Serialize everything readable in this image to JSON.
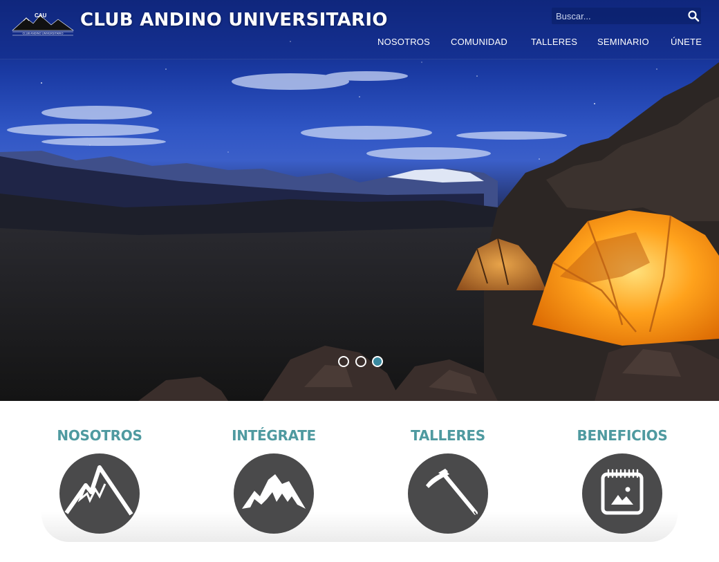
{
  "header": {
    "logo_text": "CAU",
    "logo_subtext": "CLUB ANDINO UNIVERSITARIO",
    "title": "CLUB ANDINO UNIVERSITARIO",
    "search": {
      "placeholder": "Buscar..."
    },
    "nav": [
      {
        "label": "NOSOTROS"
      },
      {
        "label": "COMUNIDAD"
      },
      {
        "label": "TALLERES"
      },
      {
        "label": "SEMINARIO"
      },
      {
        "label": "ÚNETE"
      }
    ]
  },
  "carousel": {
    "slides": 3,
    "active_index": 2,
    "active_color": "#3a8aa0"
  },
  "features": [
    {
      "title": "NOSOTROS",
      "icon": "mountain-icon"
    },
    {
      "title": "INTÉGRATE",
      "icon": "mountain-peaks-icon"
    },
    {
      "title": "TALLERES",
      "icon": "ice-axe-icon"
    },
    {
      "title": "BENEFICIOS",
      "icon": "calendar-image-icon"
    }
  ],
  "colors": {
    "accent_teal": "#4f9aa0",
    "icon_circle": "#4a4a4b",
    "tent_orange": "#ff9a1a"
  }
}
